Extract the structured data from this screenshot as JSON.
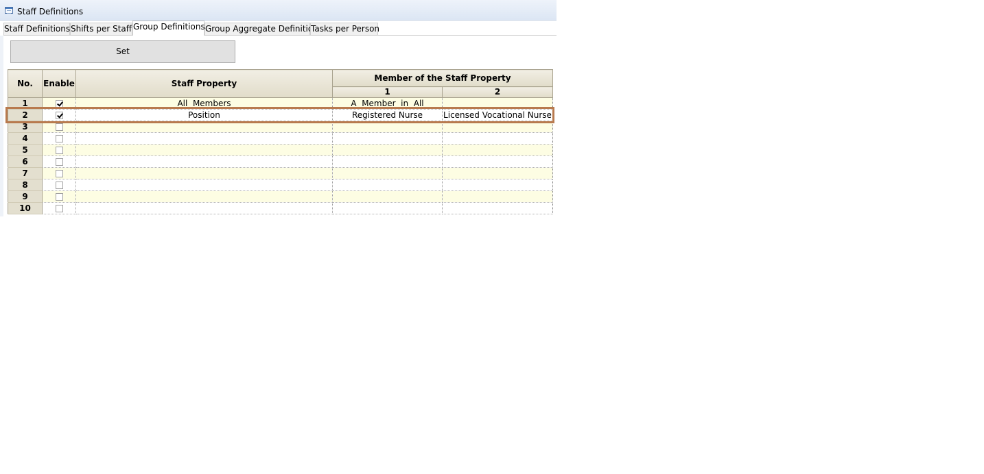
{
  "window": {
    "title": "Staff Definitions"
  },
  "tabs": [
    {
      "label": "Staff Definitions",
      "active": false
    },
    {
      "label": "Shifts per Staff",
      "active": false
    },
    {
      "label": "Group Definitions",
      "active": true
    },
    {
      "label": "Group Aggregate Definitions",
      "active": false
    },
    {
      "label": "Tasks per Person",
      "active": false
    }
  ],
  "toolbar": {
    "set_label": "Set"
  },
  "grid": {
    "headers": {
      "no": "No.",
      "enable": "Enable",
      "staff_property": "Staff Property",
      "member_group": "Member of the Staff Property",
      "member_1": "1",
      "member_2": "2"
    },
    "rows": [
      {
        "no": "1",
        "enabled": true,
        "property": "All  Members",
        "member_1": "A  Member  in  All",
        "member_2": ""
      },
      {
        "no": "2",
        "enabled": true,
        "property": "Position",
        "member_1": "Registered Nurse",
        "member_2": "Licensed Vocational Nurse"
      },
      {
        "no": "3",
        "enabled": false,
        "property": "",
        "member_1": "",
        "member_2": ""
      },
      {
        "no": "4",
        "enabled": false,
        "property": "",
        "member_1": "",
        "member_2": ""
      },
      {
        "no": "5",
        "enabled": false,
        "property": "",
        "member_1": "",
        "member_2": ""
      },
      {
        "no": "6",
        "enabled": false,
        "property": "",
        "member_1": "",
        "member_2": ""
      },
      {
        "no": "7",
        "enabled": false,
        "property": "",
        "member_1": "",
        "member_2": ""
      },
      {
        "no": "8",
        "enabled": false,
        "property": "",
        "member_1": "",
        "member_2": ""
      },
      {
        "no": "9",
        "enabled": false,
        "property": "",
        "member_1": "",
        "member_2": ""
      },
      {
        "no": "10",
        "enabled": false,
        "property": "",
        "member_1": "",
        "member_2": ""
      }
    ]
  },
  "highlight_color": "#b87a4e",
  "row_band_color": "#fdfde3"
}
